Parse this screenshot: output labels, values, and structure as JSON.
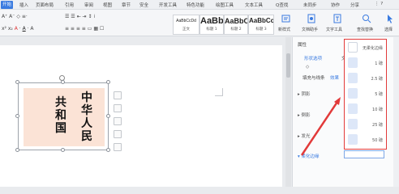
{
  "ribbon": {
    "tabs": [
      "开始",
      "插入",
      "页面布局",
      "引用",
      "审阅",
      "视图",
      "章节",
      "安全",
      "开发工具",
      "特色功能",
      "绘图工具",
      "文本工具"
    ],
    "search_label": "Q查找",
    "account": [
      "未同步",
      "协作",
      "分享"
    ],
    "styles": [
      {
        "sample": "AaBbCcDd",
        "name": "正文"
      },
      {
        "sample": "AaBb",
        "name": "标题 1"
      },
      {
        "sample": "AaBbC",
        "name": "标题 2"
      },
      {
        "sample": "AaBbCc",
        "name": "标题 3"
      }
    ],
    "buttons": [
      "新样式",
      "文档助手",
      "文字工具",
      "查找替换",
      "选择"
    ]
  },
  "document": {
    "col1": "中华人民",
    "col2": "共和国"
  },
  "panel": {
    "title": "属性",
    "tab_fill": "形状选项",
    "tab_text": "文",
    "subtab_fill": "填充与线条",
    "subtab_effect": "效果",
    "sections": [
      "阴影",
      "倒影",
      "发光",
      "柔化边缘"
    ]
  },
  "soft_edge_options": [
    "无柔化边缘",
    "1 磅",
    "2.5 磅",
    "5 磅",
    "10 磅",
    "25 磅",
    "50 磅"
  ],
  "colors": {
    "highlight": "#e23a3a",
    "fill": "#fbe3d6",
    "accent": "#3a7be0"
  }
}
